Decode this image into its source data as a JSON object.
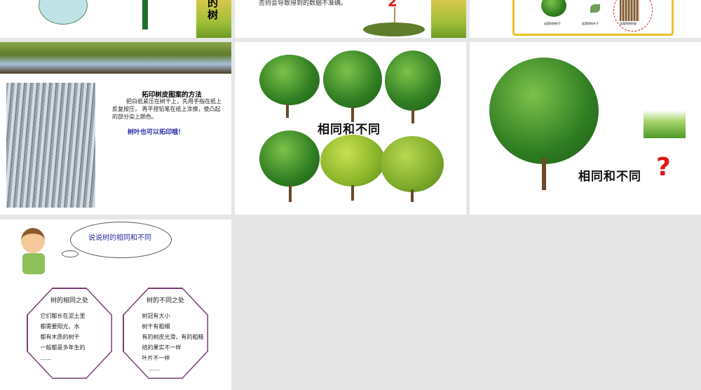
{
  "slides": [
    {
      "title_fragment": "的\n树"
    },
    {
      "text": "否则会导致得到的数据不准确。",
      "number": "2"
    },
    {
      "captions": [
        "这是树的样子",
        "这是树的叶子",
        "这是树的树皮"
      ]
    },
    {
      "title": "拓印树皮图案的方法",
      "body": "把白纸紧压在树干上，先用手指在纸上反复按压， 再平捏铅笔在纸上涂擦，使凸起的部分染上颜色。",
      "note": "树叶也可以拓印哦！"
    },
    {
      "label": "相同和不同"
    },
    {
      "label": "相同和不同",
      "mark": "?"
    },
    {
      "bubble": "说说树的相同和不同",
      "same": {
        "title": "树的相同之处",
        "items": [
          "它们都长在泥土里",
          "都需要阳光、水",
          "都有木质的树干",
          "一般都是多年生的",
          "……"
        ]
      },
      "diff": {
        "title": "树的不同之处",
        "items": [
          "树冠有大小",
          "树干有粗细",
          "有的树皮光滑、有的粗糙",
          "结的果实不一样",
          "叶片不一样",
          "……"
        ]
      }
    }
  ]
}
